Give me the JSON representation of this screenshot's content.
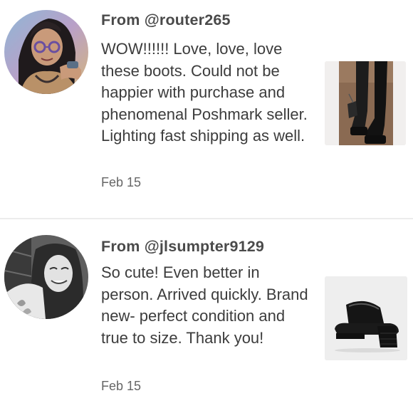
{
  "reviews": [
    {
      "from_label": "From @router265",
      "text": "WOW!!!!!! Love, love, love these boots. Could not be happier with purchase and phenomenal Poshmark seller. Lighting fast shipping as well.",
      "date": "Feb 15",
      "avatar_icon": "user-avatar-photo",
      "product_icon": "thigh-high-platform-boots-photo"
    },
    {
      "from_label": "From @jlsumpter9129",
      "text": "So cute! Even better in person. Arrived quickly. Brand new- perfect condition and true to size. Thank you!",
      "date": "Feb 15",
      "avatar_icon": "user-avatar-photo",
      "product_icon": "platform-mule-sandal-photo"
    }
  ],
  "colors": {
    "username": "#4a4a4a",
    "body_text": "#3c3c3c",
    "date": "#666666",
    "divider": "#ececec",
    "background": "#ffffff"
  }
}
